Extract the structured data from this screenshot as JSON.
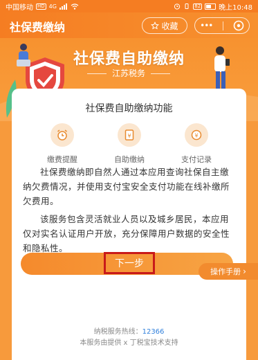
{
  "status_bar": {
    "carrier": "中国移动",
    "hd": "HD",
    "network": "4G",
    "battery": "82",
    "time_text": "晚上10:48"
  },
  "titlebar": {
    "app_title": "社保费缴纳",
    "favorite_label": "收藏",
    "more_label": "•••"
  },
  "hero": {
    "title": "社保费自助缴纳",
    "subtitle": "江苏税务"
  },
  "card": {
    "title": "社保费自助缴纳功能",
    "features": [
      {
        "label": "缴费提醒",
        "icon": "alarm-clock-icon"
      },
      {
        "label": "自助缴纳",
        "icon": "payment-document-icon"
      },
      {
        "label": "支付记录",
        "icon": "payment-record-icon"
      }
    ],
    "paragraph1": "社保费缴纳即自然人通过本应用查询社保自主缴纳欠费情况，并使用支付宝安全支付功能在线补缴所欠费用。",
    "paragraph2": "该服务包含灵活就业人员以及城乡居民，本应用仅对实名认证用户开放，充分保障用户数据的安全性和隐私性。",
    "next_label": "下一步"
  },
  "manual_label": "操作手册",
  "footer": {
    "hotline_label": "纳税服务热线：",
    "hotline_number": "12366",
    "provider": "本服务由提供 x 丁税宝技术支持"
  },
  "colors": {
    "brand_orange": "#f57d22",
    "card_bg": "#ffffff",
    "highlight_red": "#c81a1a",
    "link_blue": "#2f7fdb"
  }
}
